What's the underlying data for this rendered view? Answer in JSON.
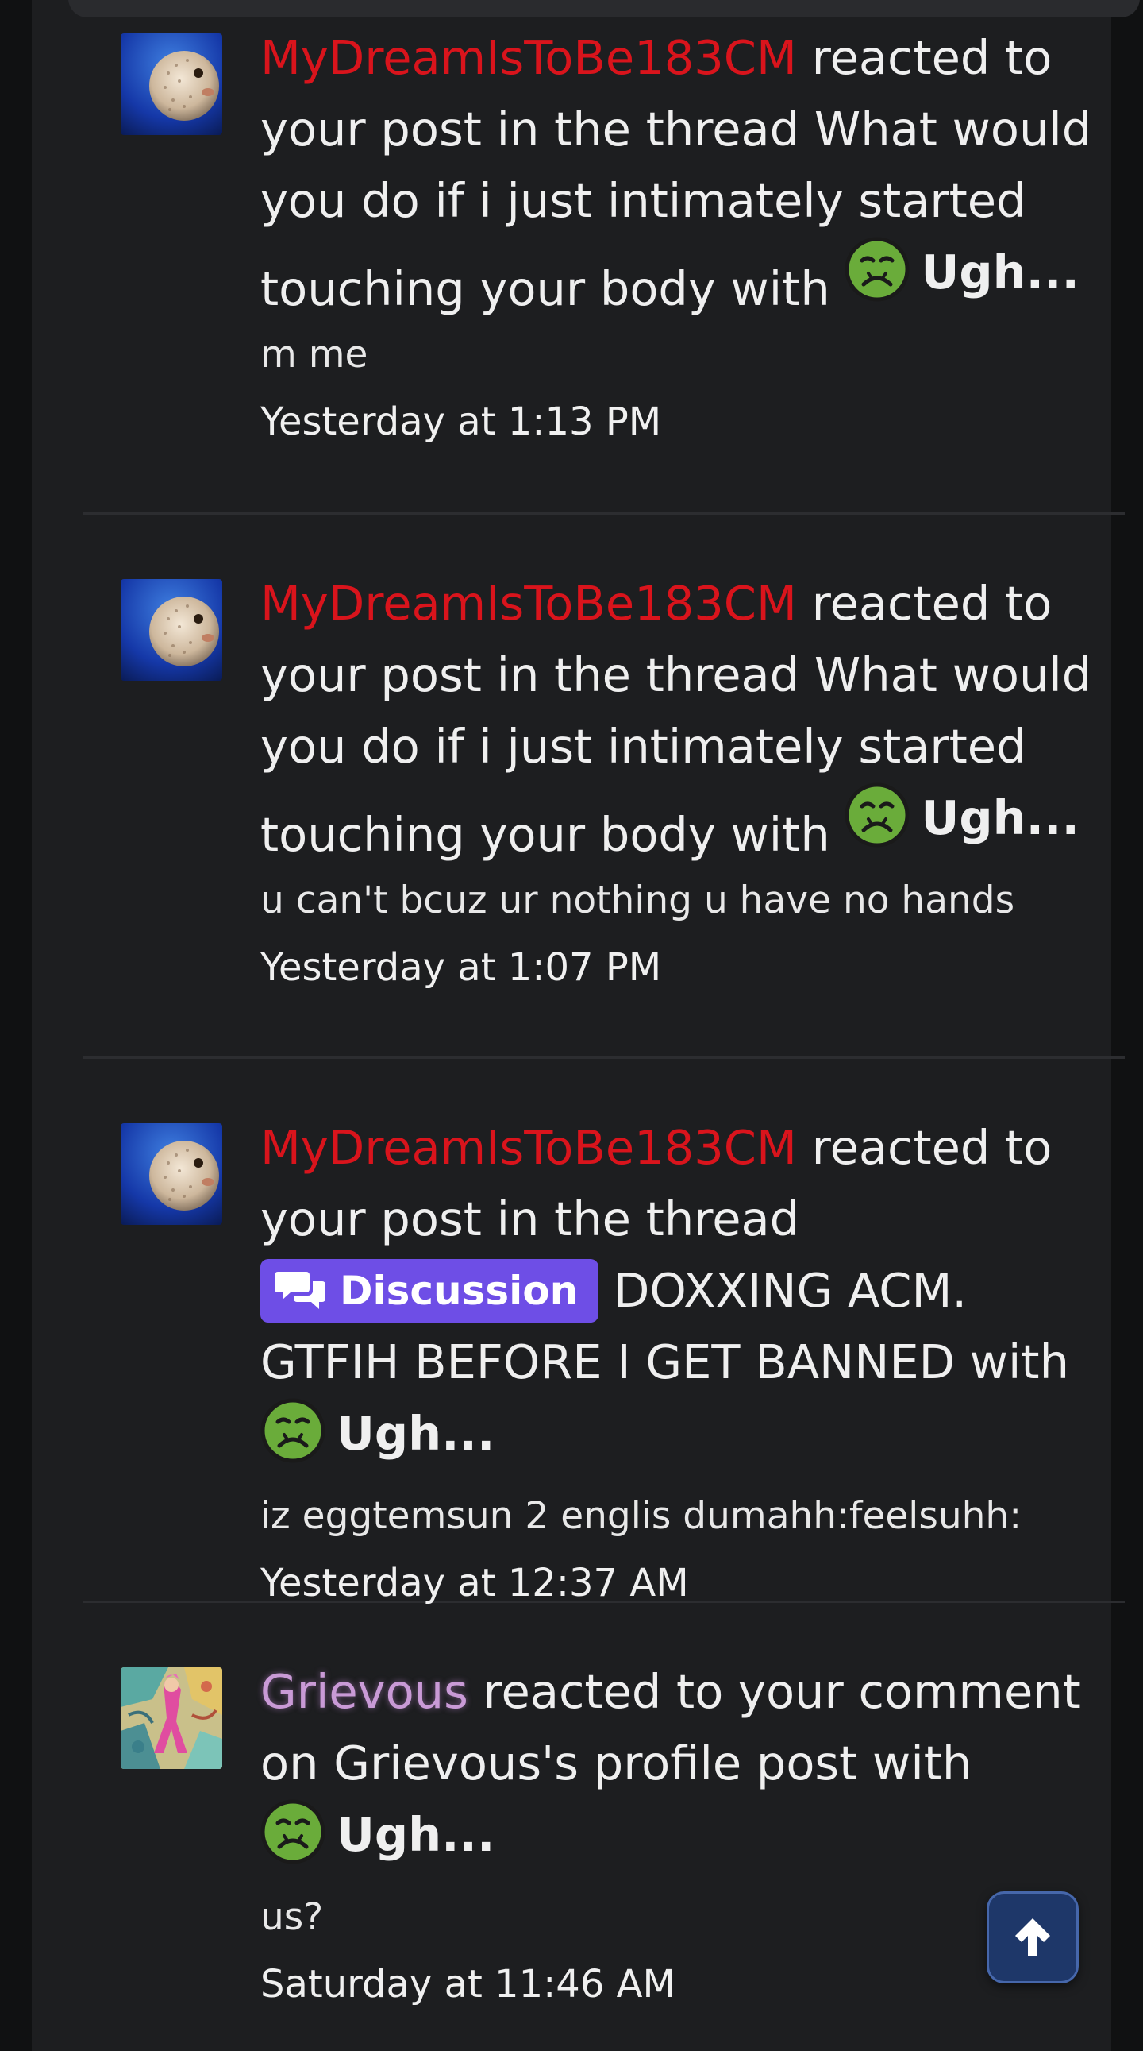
{
  "notifications": [
    {
      "user": "MyDreamIsToBe183CM",
      "user_color": "#d9141c",
      "avatar_icon": "pufferfish-avatar",
      "text_before": " reacted to your post in the thread What would you do if i just intimately started touching your body with ",
      "reaction": "Ugh...",
      "snippet": "m me",
      "time": "Yesterday at 1:13 PM"
    },
    {
      "user": "MyDreamIsToBe183CM",
      "user_color": "#d9141c",
      "avatar_icon": "pufferfish-avatar",
      "text_before": " reacted to your post in the thread What would you do if i just intimately started touching your body with ",
      "reaction": "Ugh...",
      "snippet": "u can't bcuz ur nothing u have no hands",
      "time": "Yesterday at 1:07 PM"
    },
    {
      "user": "MyDreamIsToBe183CM",
      "user_color": "#d9141c",
      "avatar_icon": "pufferfish-avatar",
      "text_before": " reacted to your post in the thread ",
      "prefix_badge": "Discussion",
      "prefix_color": "#6e4ee6",
      "text_after_badge": " DOXXING ACM. GTFIH BEFORE I GET BANNED with ",
      "reaction": "Ugh...",
      "snippet": "iz eggtemsun 2 englis dumahh:feelsuhh:",
      "time": "Yesterday at 12:37 AM"
    },
    {
      "user": "Grievous",
      "user_color": "#c99ad6",
      "avatar_icon": "anime-art-avatar",
      "text_before": " reacted to your comment on Grievous's profile post with ",
      "reaction": "Ugh...",
      "snippet": "us?",
      "time": "Saturday at 11:46 AM"
    }
  ],
  "reaction_icon": "nauseated-face-icon",
  "scroll_top_icon": "arrow-up-icon"
}
